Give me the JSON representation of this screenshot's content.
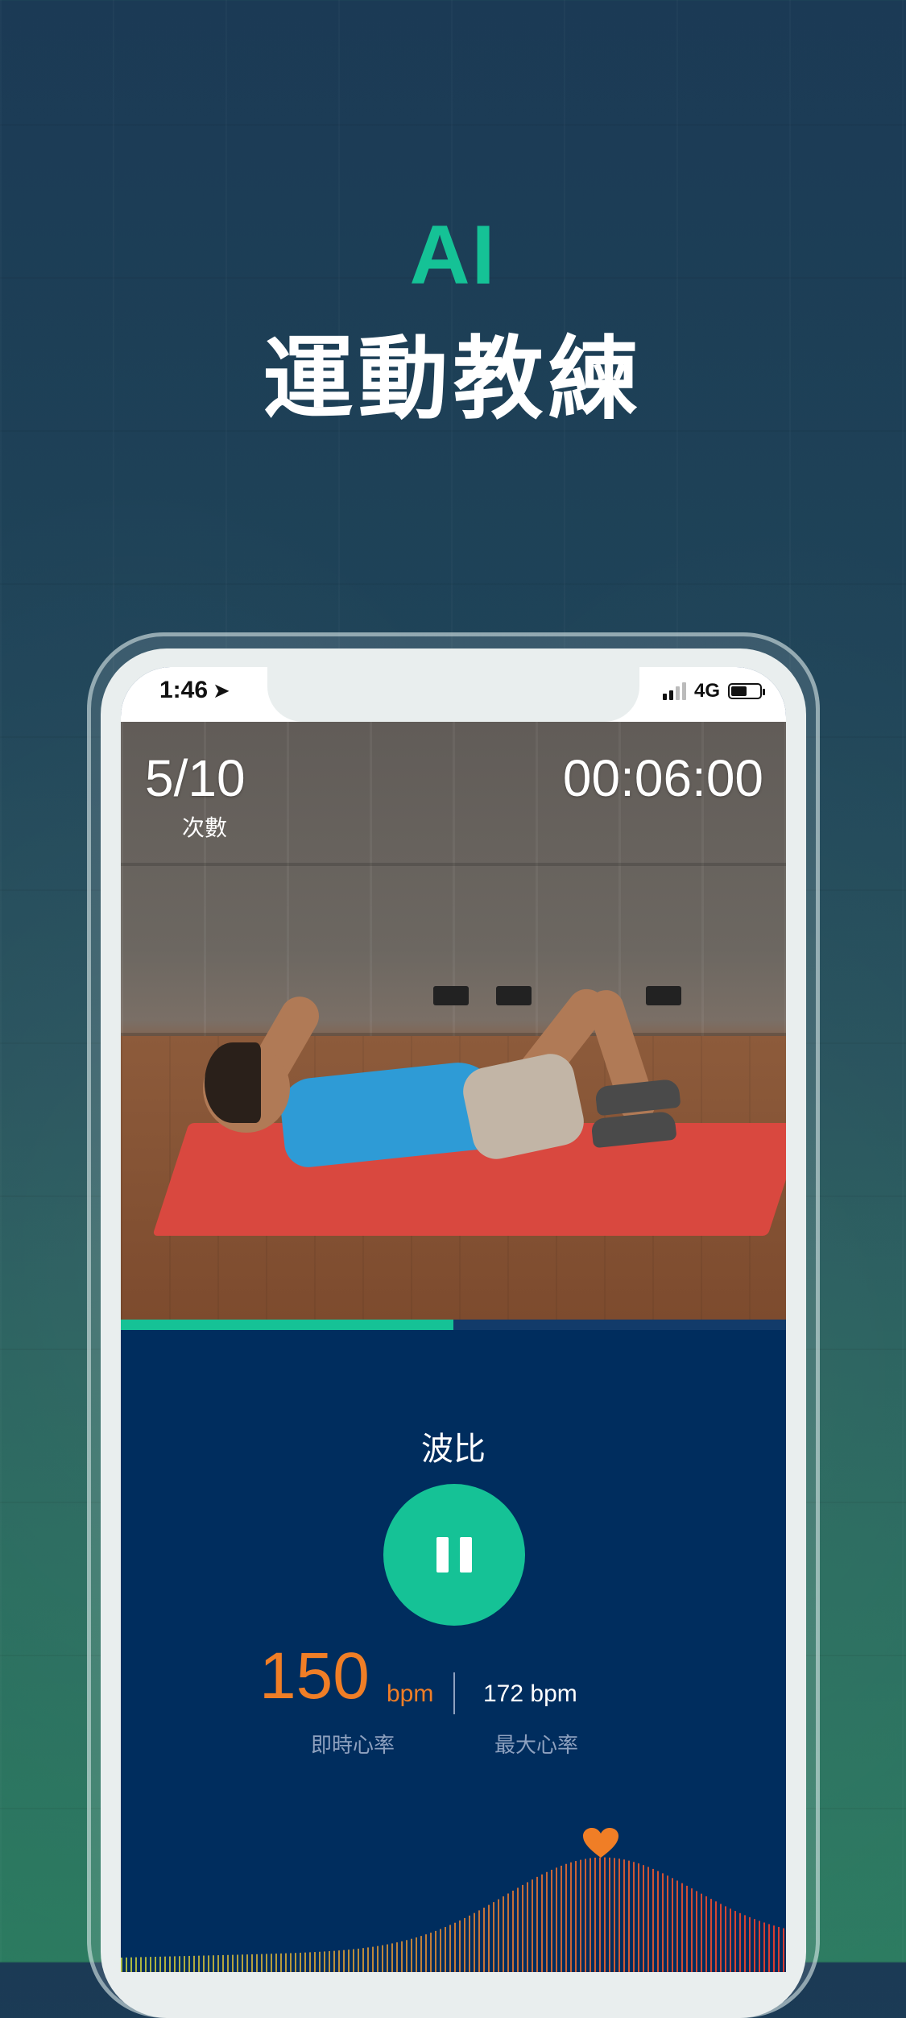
{
  "hero": {
    "ai_label": "AI",
    "title": "運動教練"
  },
  "status_bar": {
    "time": "1:46",
    "network": "4G",
    "signal_bars": 2,
    "battery_level": 0.55
  },
  "workout": {
    "count": "5/10",
    "count_label": "次數",
    "timer": "00:06:00",
    "progress": 0.5,
    "exercise_name": "波比"
  },
  "heart_rate": {
    "current_value": "150",
    "current_unit": "bpm",
    "current_label": "即時心率",
    "max_value": "172 bpm",
    "max_label": "最大心率"
  },
  "colors": {
    "accent": "#15c296",
    "heart_rate": "#f07e26",
    "panel": "#002d5e"
  },
  "icons": {
    "location": "location-arrow-icon",
    "pause": "pause-icon",
    "heart": "heart-icon"
  }
}
